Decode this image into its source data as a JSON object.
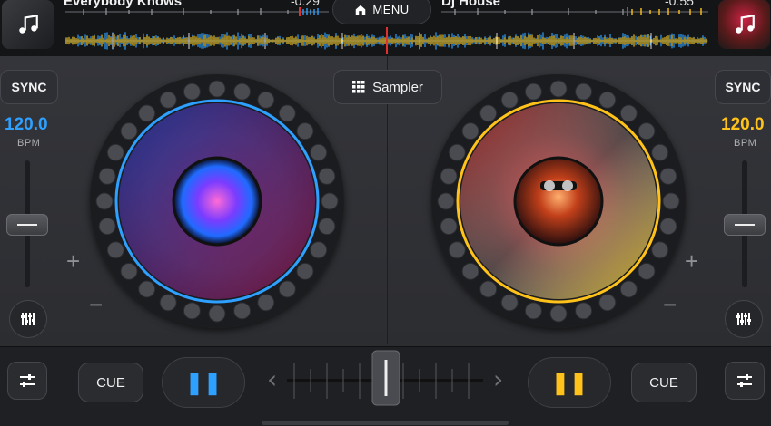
{
  "top": {
    "menu_label": "MENU",
    "left_track": {
      "title": "Everybody Knows",
      "time": "-0:29"
    },
    "right_track": {
      "title": "Dj House",
      "time": "-0:55"
    }
  },
  "sampler_label": "Sampler",
  "left_deck": {
    "sync_label": "SYNC",
    "bpm": "120.0",
    "bpm_label": "BPM",
    "cue_label": "CUE",
    "accent": "#2ea0ff"
  },
  "right_deck": {
    "sync_label": "SYNC",
    "bpm": "120.0",
    "bpm_label": "BPM",
    "cue_label": "CUE",
    "accent": "#ffc21a"
  },
  "symbols": {
    "plus": "+",
    "minus": "−",
    "pause": "❚❚",
    "chevron_left": "‹",
    "chevron_right": "›"
  },
  "icons": [
    "music-note-icon",
    "home-icon",
    "grid-icon",
    "equalizer-icon",
    "mixer-sliders-icon"
  ]
}
